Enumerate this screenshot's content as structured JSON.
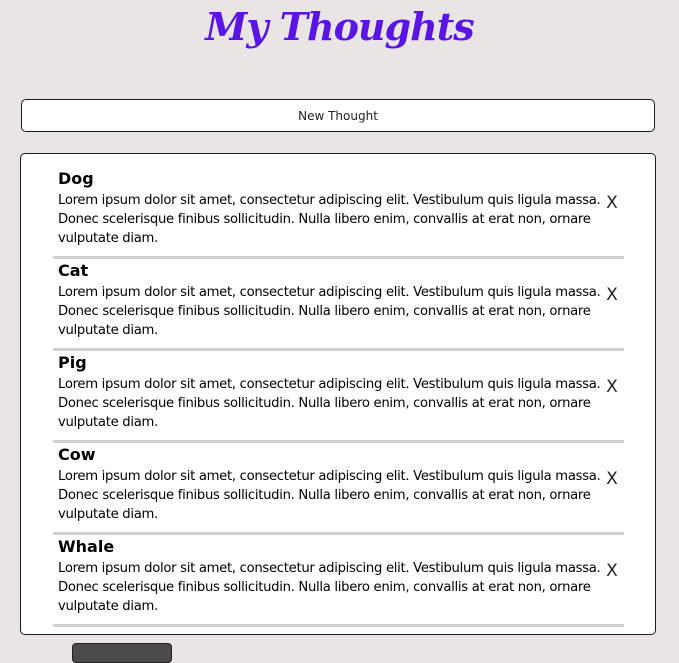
{
  "app": {
    "title": "My Thoughts"
  },
  "toolbar": {
    "new_thought_label": "New Thought"
  },
  "thoughts": [
    {
      "title": "Dog",
      "body": "Lorem ipsum dolor sit amet, consectetur adipiscing elit. Vestibulum quis ligula massa. Donec scelerisque finibus sollicitudin. Nulla libero enim, convallis at erat non, ornare vulputate diam.",
      "delete_label": "X"
    },
    {
      "title": "Cat",
      "body": "Lorem ipsum dolor sit amet, consectetur adipiscing elit. Vestibulum quis ligula massa. Donec scelerisque finibus sollicitudin. Nulla libero enim, convallis at erat non, ornare vulputate diam.",
      "delete_label": "X"
    },
    {
      "title": "Pig",
      "body": "Lorem ipsum dolor sit amet, consectetur adipiscing elit. Vestibulum quis ligula massa. Donec scelerisque finibus sollicitudin. Nulla libero enim, convallis at erat non, ornare vulputate diam.",
      "delete_label": "X"
    },
    {
      "title": "Cow",
      "body": "Lorem ipsum dolor sit amet, consectetur adipiscing elit. Vestibulum quis ligula massa. Donec scelerisque finibus sollicitudin. Nulla libero enim, convallis at erat non, ornare vulputate diam.",
      "delete_label": "X"
    },
    {
      "title": "Whale",
      "body": "Lorem ipsum dolor sit amet, consectetur adipiscing elit. Vestibulum quis ligula massa. Donec scelerisque finibus sollicitudin. Nulla libero enim, convallis at erat non, ornare vulputate diam.",
      "delete_label": "X"
    }
  ],
  "colors": {
    "title": "#5a14e6",
    "background": "#e9e5e5",
    "divider": "#d0d0d0"
  }
}
